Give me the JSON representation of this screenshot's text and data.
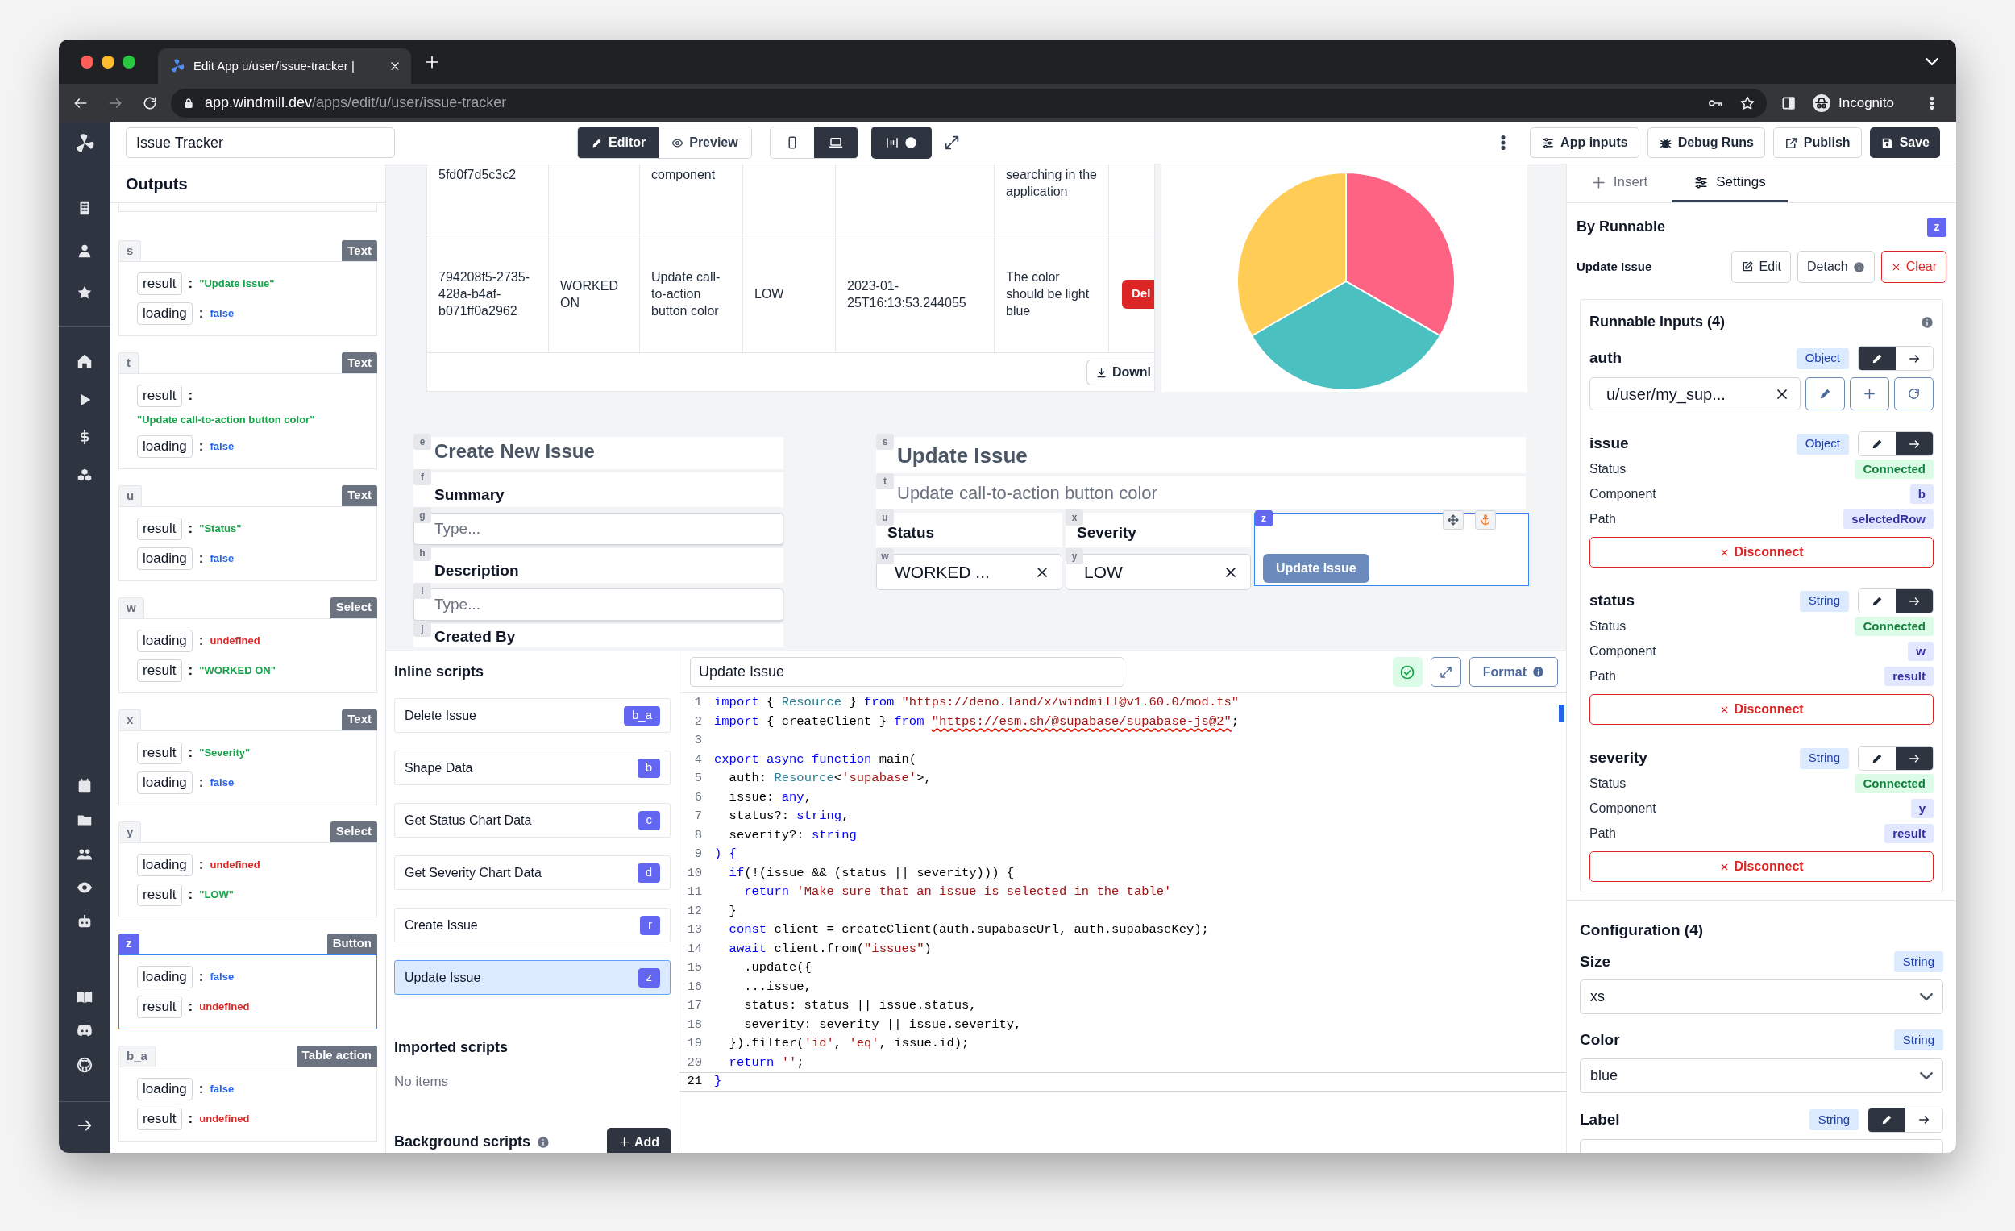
{
  "browser": {
    "tab_title": "Edit App u/user/issue-tracker |",
    "url_host": "app.windmill.dev",
    "url_path": "/apps/edit/u/user/issue-tracker",
    "profile_label": "Incognito"
  },
  "toolbar": {
    "app_name": "Issue Tracker",
    "modes": [
      {
        "label": "Editor",
        "kind": "editor",
        "selected": true
      },
      {
        "label": "Preview",
        "kind": "preview",
        "selected": false
      }
    ],
    "devices": [
      {
        "kind": "mobile",
        "selected": false
      },
      {
        "kind": "desktop",
        "selected": true
      }
    ],
    "layout_toggle_on": true,
    "actions": [
      {
        "label": "App inputs",
        "kind": "app-inputs"
      },
      {
        "label": "Debug Runs",
        "kind": "debug"
      },
      {
        "label": "Publish",
        "kind": "publish"
      },
      {
        "label": "Save",
        "kind": "save"
      }
    ]
  },
  "outputs": {
    "title": "Outputs",
    "separator": ":",
    "components": [
      {
        "id": "s",
        "type": "Text",
        "selected": false,
        "fields": [
          {
            "key": "result",
            "value": "\"Update Issue\"",
            "kind": "string"
          },
          {
            "key": "loading",
            "value": "false",
            "kind": "boolean"
          }
        ]
      },
      {
        "id": "t",
        "type": "Text",
        "selected": false,
        "fields": [
          {
            "key": "result",
            "value": "\"Update call-to-action button color\"",
            "kind": "string"
          },
          {
            "key": "loading",
            "value": "false",
            "kind": "boolean"
          }
        ]
      },
      {
        "id": "u",
        "type": "Text",
        "selected": false,
        "fields": [
          {
            "key": "result",
            "value": "\"Status\"",
            "kind": "string"
          },
          {
            "key": "loading",
            "value": "false",
            "kind": "boolean"
          }
        ]
      },
      {
        "id": "w",
        "type": "Select",
        "selected": false,
        "fields": [
          {
            "key": "loading",
            "value": "undefined",
            "kind": "undefined"
          },
          {
            "key": "result",
            "value": "\"WORKED ON\"",
            "kind": "string"
          }
        ]
      },
      {
        "id": "x",
        "type": "Text",
        "selected": false,
        "fields": [
          {
            "key": "result",
            "value": "\"Severity\"",
            "kind": "string"
          },
          {
            "key": "loading",
            "value": "false",
            "kind": "boolean"
          }
        ]
      },
      {
        "id": "y",
        "type": "Select",
        "selected": false,
        "fields": [
          {
            "key": "loading",
            "value": "undefined",
            "kind": "undefined"
          },
          {
            "key": "result",
            "value": "\"LOW\"",
            "kind": "string"
          }
        ]
      },
      {
        "id": "z",
        "type": "Button",
        "selected": true,
        "fields": [
          {
            "key": "loading",
            "value": "false",
            "kind": "boolean"
          },
          {
            "key": "result",
            "value": "undefined",
            "kind": "undefined"
          }
        ]
      },
      {
        "id": "b_a",
        "type": "Table action",
        "selected": false,
        "fields": [
          {
            "key": "loading",
            "value": "false",
            "kind": "boolean"
          },
          {
            "key": "result",
            "value": "undefined",
            "kind": "undefined"
          }
        ]
      }
    ]
  },
  "canvas": {
    "table": {
      "rows": [
        {
          "column_1": "5fd0f7d5c3c2",
          "column_3": "component",
          "column_6": "searching in the application"
        },
        {
          "column_1": "794208f5-2735-428a-b4af-b071ff0a2962",
          "column_2": "WORKED ON",
          "column_3": "Update call-to-action button color",
          "column_4": "LOW",
          "column_5": "2023-01-25T16:13:53.244055",
          "column_6": "The color should be light blue",
          "action": "Del"
        }
      ],
      "download_label": "Downl"
    },
    "create_form": [
      {
        "id": "e",
        "kind": "title",
        "text": "Create New Issue"
      },
      {
        "id": "f",
        "kind": "label",
        "text": "Summary"
      },
      {
        "id": "g",
        "kind": "input",
        "placeholder": "Type..."
      },
      {
        "id": "h",
        "kind": "label",
        "text": "Description"
      },
      {
        "id": "i",
        "kind": "input",
        "placeholder": "Type..."
      },
      {
        "id": "j",
        "kind": "label",
        "text": "Created By"
      }
    ],
    "update_form": {
      "title": {
        "id": "s",
        "text": "Update Issue"
      },
      "subtitle": {
        "id": "t",
        "text": "Update call-to-action button color"
      },
      "fields": [
        {
          "label_id": "u",
          "label": "Status",
          "select_id": "w",
          "value": "WORKED ..."
        },
        {
          "label_id": "x",
          "label": "Severity",
          "select_id": "y",
          "value": "LOW"
        }
      ],
      "button": {
        "id": "z",
        "label": "Update Issue",
        "selected": true
      }
    }
  },
  "scripts": {
    "inline_title": "Inline scripts",
    "inline": [
      {
        "name": "Delete Issue",
        "id": "b_a",
        "selected": false
      },
      {
        "name": "Shape Data",
        "id": "b",
        "selected": false
      },
      {
        "name": "Get Status Chart Data",
        "id": "c",
        "selected": false
      },
      {
        "name": "Get Severity Chart Data",
        "id": "d",
        "selected": false
      },
      {
        "name": "Create Issue",
        "id": "r",
        "selected": false
      },
      {
        "name": "Update Issue",
        "id": "z",
        "selected": true
      }
    ],
    "imported_title": "Imported scripts",
    "imported_empty": "No items",
    "background_title": "Background scripts",
    "add_label": "Add"
  },
  "editor": {
    "script_name": "Update Issue",
    "format_label": "Format",
    "lines": [
      {
        "number": "1",
        "tokens": [
          {
            "text": "import",
            "kind": "kw"
          },
          {
            "text": " { ",
            "kind": "plain"
          },
          {
            "text": "Resource",
            "kind": "type"
          },
          {
            "text": " } ",
            "kind": "plain"
          },
          {
            "text": "from ",
            "kind": "kw"
          },
          {
            "text": "\"https://deno.land/x/windmill@v1.60.0/mod.ts\"",
            "kind": "str"
          }
        ]
      },
      {
        "number": "2",
        "tokens": [
          {
            "text": "import",
            "kind": "kw"
          },
          {
            "text": " { createClient } ",
            "kind": "plain"
          },
          {
            "text": "from ",
            "kind": "kw"
          },
          {
            "text": "\"https://esm.sh/@supabase/supabase-js@2\"",
            "kind": "str_warn"
          },
          {
            "text": ";",
            "kind": "plain"
          }
        ]
      },
      {
        "number": "3"
      },
      {
        "number": "4",
        "tokens": [
          {
            "text": "export async function",
            "kind": "kw"
          },
          {
            "text": " main(",
            "kind": "plain"
          }
        ]
      },
      {
        "number": "5",
        "tokens": [
          {
            "text": "  auth: ",
            "kind": "plain"
          },
          {
            "text": "Resource",
            "kind": "type"
          },
          {
            "text": "<",
            "kind": "plain"
          },
          {
            "text": "'supabase'",
            "kind": "str"
          },
          {
            "text": ">,",
            "kind": "plain"
          }
        ]
      },
      {
        "number": "6",
        "tokens": [
          {
            "text": "  issue: ",
            "kind": "plain"
          },
          {
            "text": "any",
            "kind": "kw"
          },
          {
            "text": ",",
            "kind": "plain"
          }
        ]
      },
      {
        "number": "7",
        "tokens": [
          {
            "text": "  status?: ",
            "kind": "plain"
          },
          {
            "text": "string",
            "kind": "kw"
          },
          {
            "text": ",",
            "kind": "plain"
          }
        ]
      },
      {
        "number": "8",
        "tokens": [
          {
            "text": "  severity?: ",
            "kind": "plain"
          },
          {
            "text": "string",
            "kind": "kw"
          }
        ]
      },
      {
        "number": "9",
        "tokens": [
          {
            "text": ") {",
            "kind": "kw"
          }
        ]
      },
      {
        "number": "10",
        "tokens": [
          {
            "text": "  if",
            "kind": "kw"
          },
          {
            "text": "(!(issue && (status || severity))) {",
            "kind": "plain"
          }
        ]
      },
      {
        "number": "11",
        "tokens": [
          {
            "text": "    return ",
            "kind": "kw"
          },
          {
            "text": "'Make sure that an issue is selected in the table'",
            "kind": "str"
          }
        ]
      },
      {
        "number": "12",
        "tokens": [
          {
            "text": "  }",
            "kind": "plain"
          }
        ]
      },
      {
        "number": "13",
        "tokens": [
          {
            "text": "  const",
            "kind": "kw"
          },
          {
            "text": " client = createClient(auth.supabaseUrl, auth.supabaseKey);",
            "kind": "plain"
          }
        ]
      },
      {
        "number": "14",
        "tokens": [
          {
            "text": "  await",
            "kind": "kw"
          },
          {
            "text": " client.from(",
            "kind": "plain"
          },
          {
            "text": "\"issues\"",
            "kind": "str"
          },
          {
            "text": ")",
            "kind": "plain"
          }
        ]
      },
      {
        "number": "15",
        "tokens": [
          {
            "text": "    .update({",
            "kind": "plain"
          }
        ]
      },
      {
        "number": "16",
        "tokens": [
          {
            "text": "    ...issue,",
            "kind": "plain"
          }
        ]
      },
      {
        "number": "17",
        "tokens": [
          {
            "text": "    status: status || issue.status,",
            "kind": "plain"
          }
        ]
      },
      {
        "number": "18",
        "tokens": [
          {
            "text": "    severity: severity || issue.severity,",
            "kind": "plain"
          }
        ]
      },
      {
        "number": "19",
        "tokens": [
          {
            "text": "  }).filter(",
            "kind": "plain"
          },
          {
            "text": "'id'",
            "kind": "str"
          },
          {
            "text": ", ",
            "kind": "plain"
          },
          {
            "text": "'eq'",
            "kind": "str"
          },
          {
            "text": ", issue.id);",
            "kind": "plain"
          }
        ]
      },
      {
        "number": "20",
        "tokens": [
          {
            "text": "  return ",
            "kind": "kw"
          },
          {
            "text": "''",
            "kind": "str"
          },
          {
            "text": ";",
            "kind": "plain"
          }
        ]
      },
      {
        "number": "21",
        "current": true,
        "tokens": [
          {
            "text": "}",
            "kind": "kw"
          }
        ]
      }
    ]
  },
  "inspector": {
    "tabs": [
      {
        "label": "Insert",
        "kind": "insert",
        "selected": false
      },
      {
        "label": "Settings",
        "kind": "settings",
        "selected": true
      }
    ],
    "section_title": "By Runnable",
    "component_id": "z",
    "runnable_name": "Update Issue",
    "runnable_actions": [
      {
        "label": "Edit",
        "kind": "edit"
      },
      {
        "label": "Detach",
        "kind": "detach"
      },
      {
        "label": "Clear",
        "kind": "clear"
      }
    ],
    "inputs_title": "Runnable Inputs (4)",
    "inputs": [
      {
        "name": "auth",
        "type": "Object",
        "kind": "static",
        "modes": [
          {
            "kind": "static",
            "selected": true
          },
          {
            "kind": "connect",
            "selected": false
          }
        ],
        "value": "u/user/my_sup..."
      },
      {
        "name": "issue",
        "type": "Object",
        "kind": "connected",
        "modes": [
          {
            "kind": "static",
            "selected": false
          },
          {
            "kind": "connect",
            "selected": true
          }
        ],
        "rows": [
          {
            "label": "Status",
            "value": "Connected",
            "kind": "status"
          },
          {
            "label": "Component",
            "value": "b",
            "kind": "ref"
          },
          {
            "label": "Path",
            "value": "selectedRow",
            "kind": "ref"
          }
        ],
        "disconnect_label": "Disconnect"
      },
      {
        "name": "status",
        "type": "String",
        "kind": "connected",
        "modes": [
          {
            "kind": "static",
            "selected": false
          },
          {
            "kind": "connect",
            "selected": true
          }
        ],
        "rows": [
          {
            "label": "Status",
            "value": "Connected",
            "kind": "status"
          },
          {
            "label": "Component",
            "value": "w",
            "kind": "ref"
          },
          {
            "label": "Path",
            "value": "result",
            "kind": "ref"
          }
        ],
        "disconnect_label": "Disconnect"
      },
      {
        "name": "severity",
        "type": "String",
        "kind": "connected",
        "modes": [
          {
            "kind": "static",
            "selected": false
          },
          {
            "kind": "connect",
            "selected": true
          }
        ],
        "rows": [
          {
            "label": "Status",
            "value": "Connected",
            "kind": "status"
          },
          {
            "label": "Component",
            "value": "y",
            "kind": "ref"
          },
          {
            "label": "Path",
            "value": "result",
            "kind": "ref"
          }
        ],
        "disconnect_label": "Disconnect"
      }
    ],
    "config_title": "Configuration (4)",
    "config": [
      {
        "name": "Size",
        "type": "String",
        "kind": "select",
        "value": "xs"
      },
      {
        "name": "Color",
        "type": "String",
        "kind": "select",
        "value": "blue"
      },
      {
        "name": "Label",
        "type": "String",
        "kind": "static",
        "modes": [
          {
            "kind": "static",
            "selected": true
          },
          {
            "kind": "connect",
            "selected": false
          }
        ]
      }
    ]
  }
}
